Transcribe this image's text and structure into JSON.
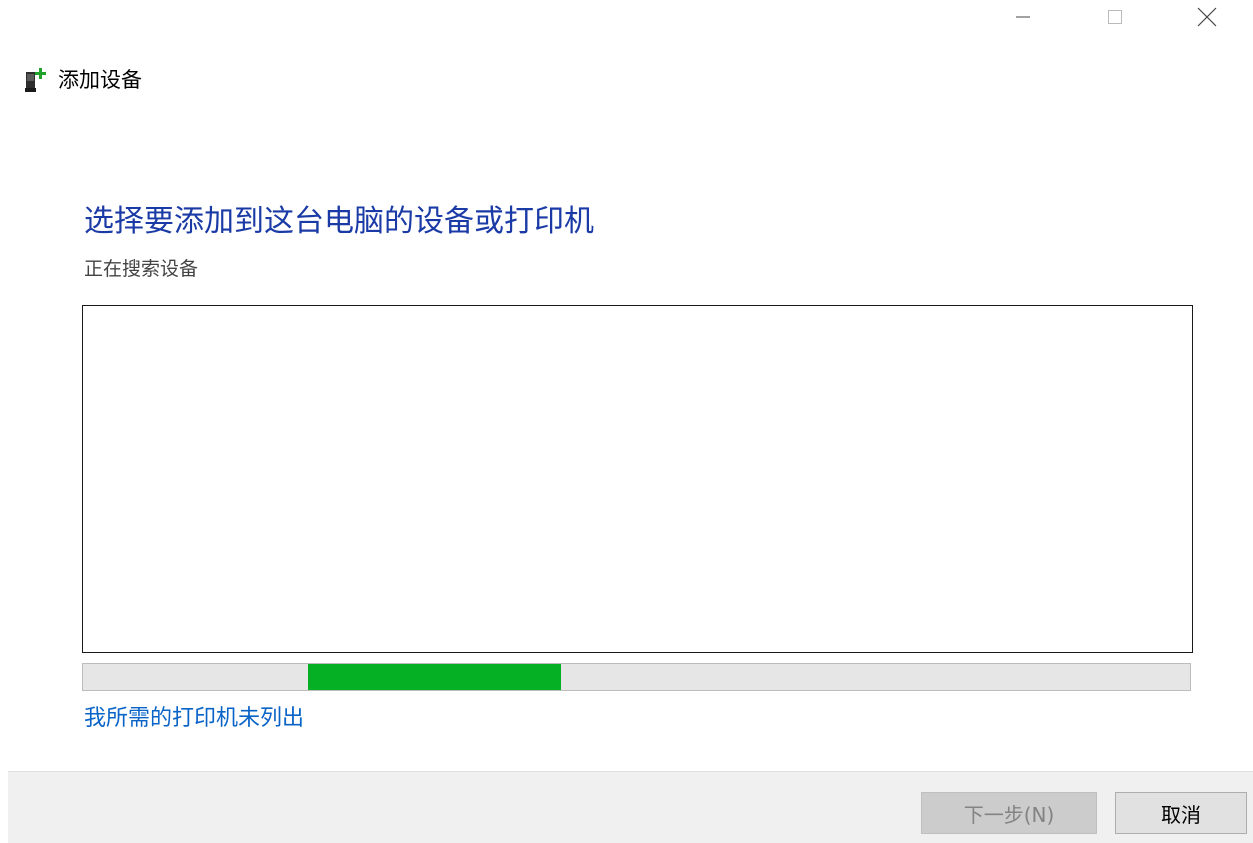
{
  "window": {
    "title": "添加设备"
  },
  "main": {
    "heading": "选择要添加到这台电脑的设备或打印机",
    "status": "正在搜索设备",
    "progress": {
      "segment_start": 0.203,
      "segment_end": 0.432,
      "color": "#06b025"
    },
    "printer_link": "我所需的打印机未列出"
  },
  "footer": {
    "next_label": "下一步(N)",
    "cancel_label": "取消"
  },
  "colors": {
    "heading": "#1a3aa6",
    "link": "#0a64c8",
    "footer_bg": "#f0f0f0"
  },
  "icons": {
    "app": "device-add-icon",
    "minimize": "minimize-icon",
    "maximize": "maximize-icon",
    "close": "close-icon"
  }
}
